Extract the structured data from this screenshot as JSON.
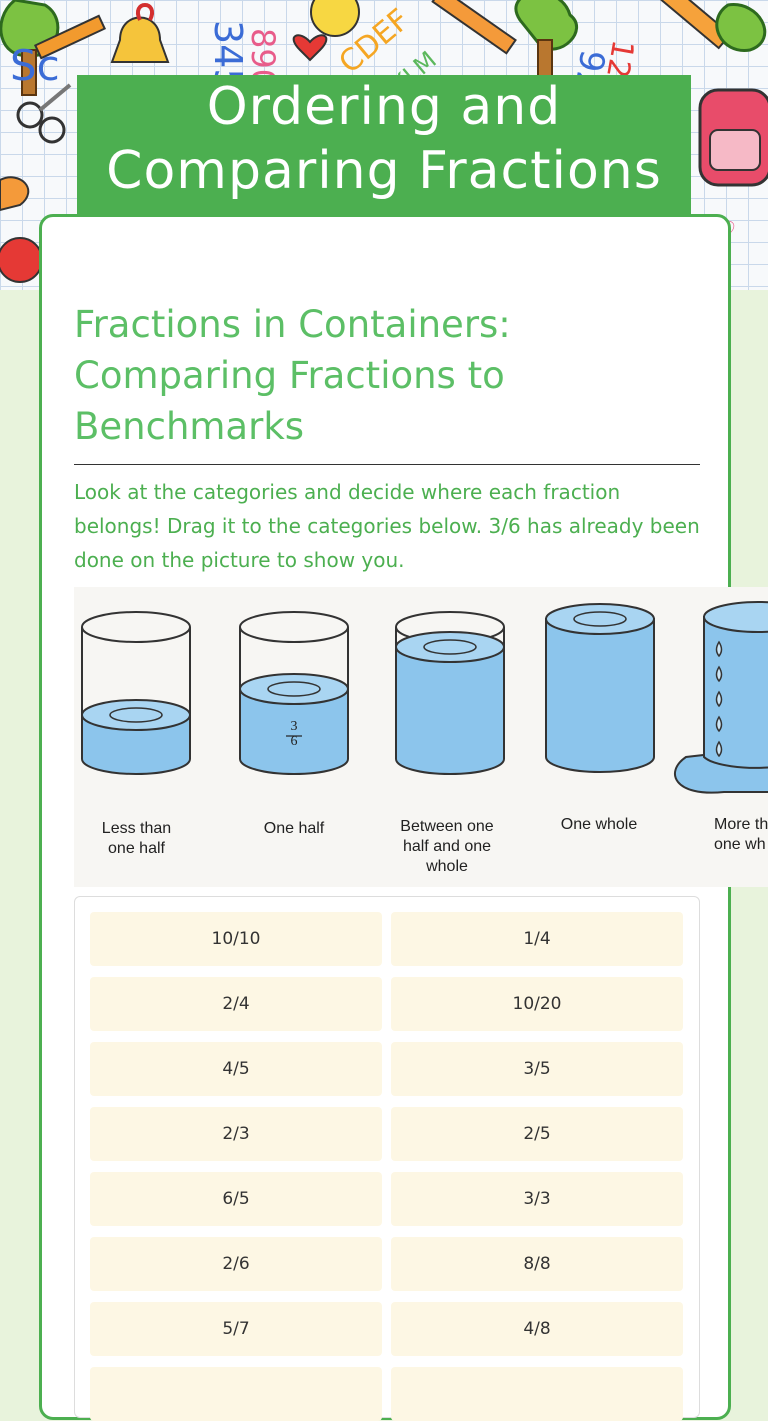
{
  "header": {
    "title_line1": "Ordering and",
    "title_line2": "Comparing Fractions"
  },
  "section": {
    "subtitle": "Fractions in Containers: Comparing Fractions to Benchmarks",
    "instructions": "Look at the categories and decide where each fraction belongs! Drag it to the categories below. 3/6 has already been done on the picture to show you."
  },
  "picture": {
    "example_fraction_num": "3",
    "example_fraction_den": "6",
    "captions": [
      "Less than one half",
      "One half",
      "Between one half and one whole",
      "One whole",
      "More th one wh"
    ]
  },
  "choices": [
    [
      "10/10",
      "1/4"
    ],
    [
      "2/4",
      "10/20"
    ],
    [
      "4/5",
      "3/5"
    ],
    [
      "2/3",
      "2/5"
    ],
    [
      "6/5",
      "3/3"
    ],
    [
      "2/6",
      "8/8"
    ],
    [
      "5/7",
      "4/8"
    ],
    [
      "",
      ""
    ]
  ],
  "colors": {
    "accent": "#4caf50",
    "subtitle": "#5cbf66",
    "chip": "#fdf7e4",
    "water": "#8cc5ec"
  }
}
